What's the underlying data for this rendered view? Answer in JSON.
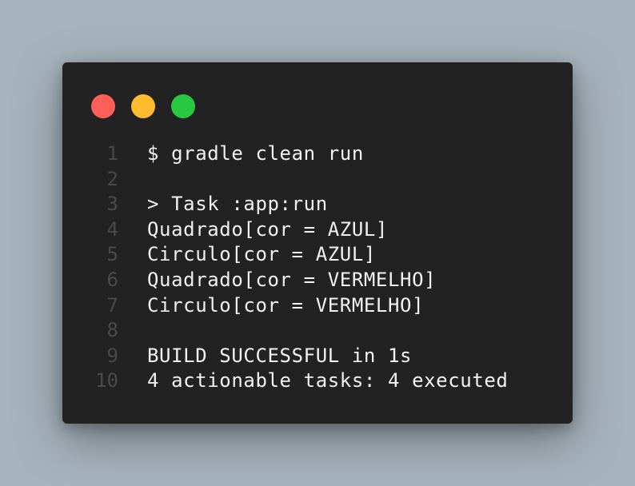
{
  "window": {
    "controls": [
      {
        "name": "close",
        "color": "#ff5f57"
      },
      {
        "name": "minimize",
        "color": "#febc2e"
      },
      {
        "name": "maximize",
        "color": "#28c840"
      }
    ]
  },
  "code": {
    "lines": [
      {
        "number": "1",
        "text": "$ gradle clean run"
      },
      {
        "number": "2",
        "text": ""
      },
      {
        "number": "3",
        "text": "> Task :app:run"
      },
      {
        "number": "4",
        "text": "Quadrado[cor = AZUL]"
      },
      {
        "number": "5",
        "text": "Circulo[cor = AZUL]"
      },
      {
        "number": "6",
        "text": "Quadrado[cor = VERMELHO]"
      },
      {
        "number": "7",
        "text": "Circulo[cor = VERMELHO]"
      },
      {
        "number": "8",
        "text": ""
      },
      {
        "number": "9",
        "text": "BUILD SUCCESSFUL in 1s"
      },
      {
        "number": "10",
        "text": "4 actionable tasks: 4 executed"
      }
    ]
  }
}
